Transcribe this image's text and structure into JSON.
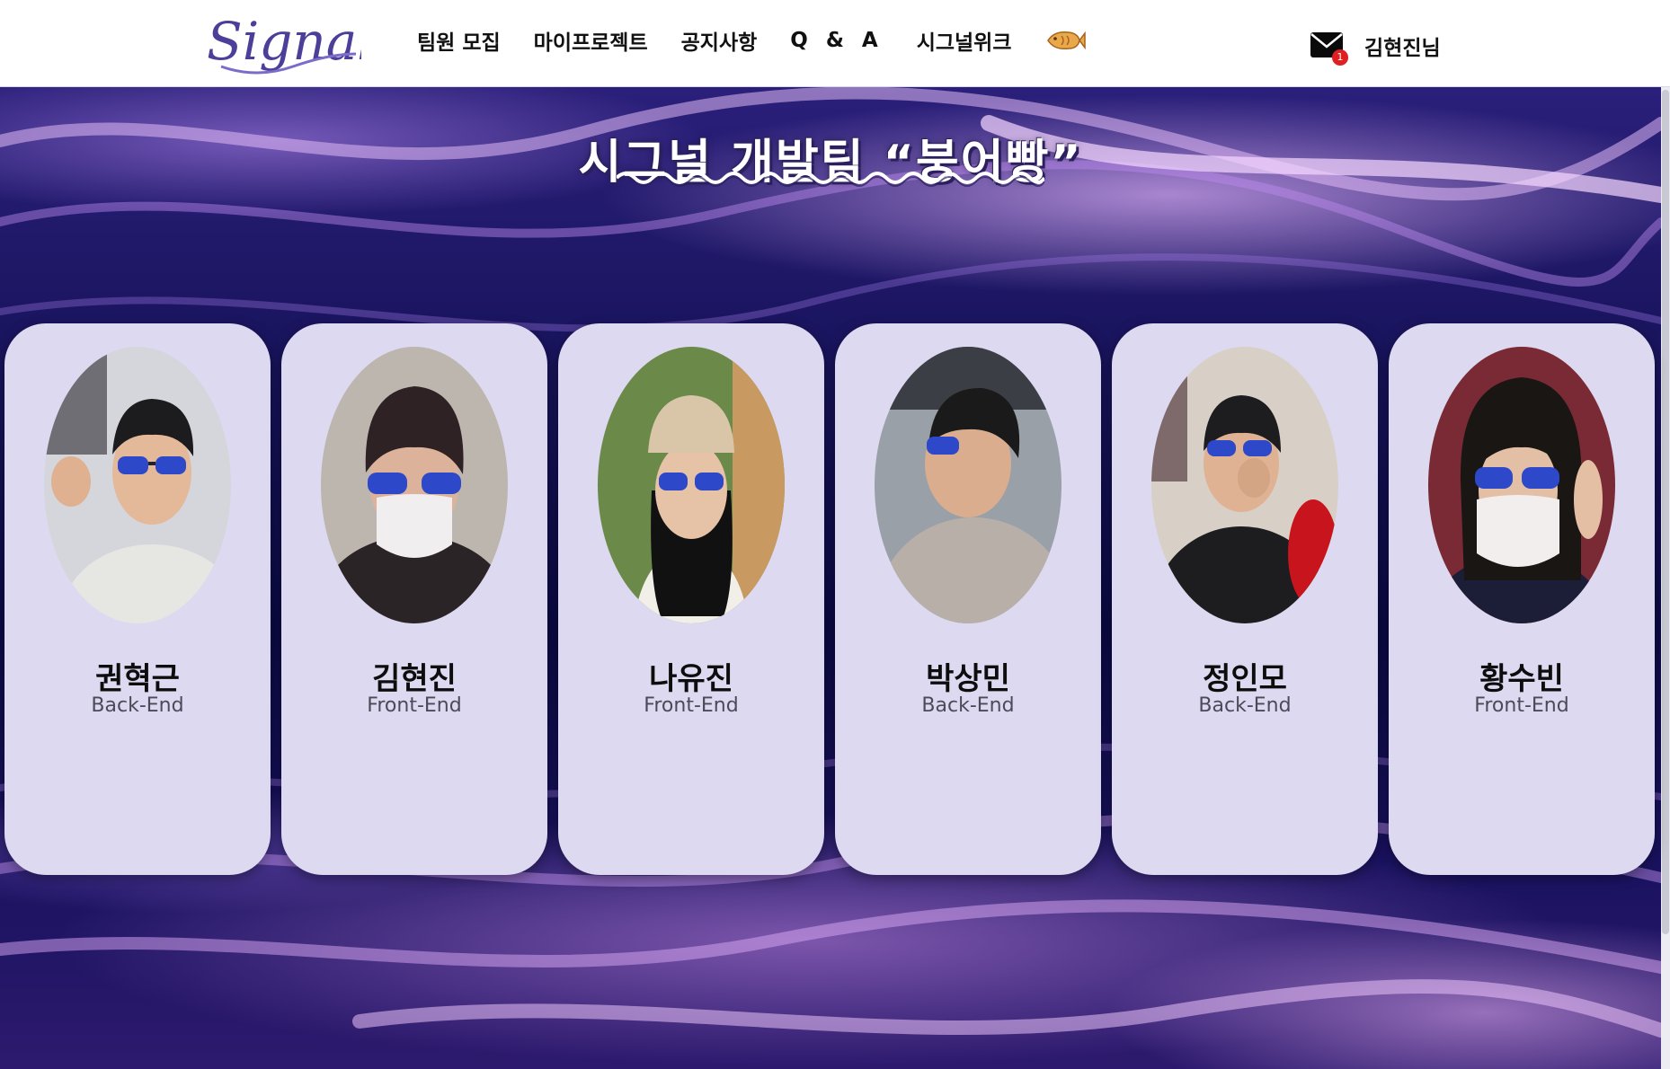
{
  "header": {
    "logo_text": "Signal",
    "nav": [
      "팀원 모집",
      "마이프로젝트",
      "공지사항",
      "Q & A",
      "시그널위크"
    ],
    "fish_icon": "bungeoppang-icon",
    "mail_icon": "envelope-icon",
    "mail_badge": "1",
    "user_name": "김현진님"
  },
  "page": {
    "title": "시그널 개발팀 “붕어빵”"
  },
  "members": [
    {
      "name": "권혁근",
      "role": "Back-End"
    },
    {
      "name": "김현진",
      "role": "Front-End"
    },
    {
      "name": "나유진",
      "role": "Front-End"
    },
    {
      "name": "박상민",
      "role": "Back-End"
    },
    {
      "name": "정인모",
      "role": "Back-End"
    },
    {
      "name": "황수빈",
      "role": "Front-End"
    }
  ],
  "colors": {
    "card_bg": "#ddd9f0",
    "logo": "#4b3f9a",
    "badge": "#e02020"
  }
}
